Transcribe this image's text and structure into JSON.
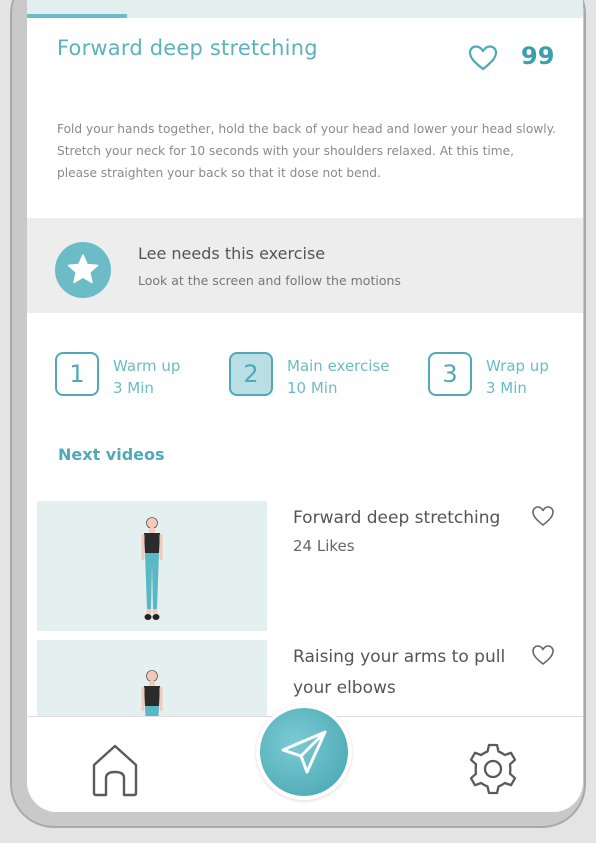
{
  "exercise": {
    "title": "Forward deep stretching",
    "favorite_count": "99",
    "progress_percent": 18,
    "description": "Fold your hands together, hold the back of your head and lower your head slowly. Stretch your neck for 10 seconds with your shoulders relaxed. At this time, please straighten your back so that it dose not bend."
  },
  "recommendation": {
    "icon": "star-icon",
    "title": "Lee needs this exercise",
    "subtitle": "Look at the screen and follow the motions"
  },
  "steps": [
    {
      "number": "1",
      "title": "Warm up",
      "duration": "3 Min",
      "active": false
    },
    {
      "number": "2",
      "title": "Main exercise",
      "duration": "10 Min",
      "active": true
    },
    {
      "number": "3",
      "title": "Wrap up",
      "duration": "3 Min",
      "active": false
    }
  ],
  "next_videos": {
    "heading": "Next videos",
    "items": [
      {
        "title": "Forward deep stretching",
        "likes": "24 Likes"
      },
      {
        "title": "Raising your arms to pull your elbows",
        "likes": ""
      }
    ]
  },
  "nav": {
    "home_icon": "home-icon",
    "center_icon": "paper-plane-icon",
    "settings_icon": "gear-icon"
  },
  "colors": {
    "accent": "#6bbcc6",
    "accent_dark": "#3c9fae",
    "banner_bg": "#ededed",
    "thumb_bg": "#e4efef"
  }
}
